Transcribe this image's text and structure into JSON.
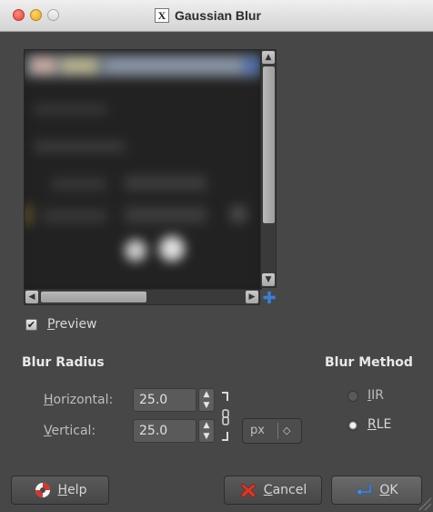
{
  "window": {
    "title": "Gaussian Blur"
  },
  "preview": {
    "label": "Preview",
    "checked": true
  },
  "blur_radius": {
    "heading": "Blur Radius",
    "horizontal_label": "Horizontal:",
    "horizontal_value": "25.0",
    "vertical_label": "Vertical:",
    "vertical_value": "25.0",
    "unit": "px"
  },
  "blur_method": {
    "heading": "Blur Method",
    "options": [
      {
        "label": "IIR",
        "selected": false
      },
      {
        "label": "RLE",
        "selected": true
      }
    ]
  },
  "buttons": {
    "help": "Help",
    "cancel": "Cancel",
    "ok": "OK"
  },
  "icons": {
    "help": "lifebuoy-icon",
    "cancel": "red-x-icon",
    "ok": "enter-arrow-icon",
    "navigate": "four-way-arrow-icon",
    "chain": "chain-link-icon"
  },
  "colors": {
    "window_bg": "#474747",
    "accent_blue": "#3a7fd6",
    "cancel_red": "#d43a2a"
  }
}
